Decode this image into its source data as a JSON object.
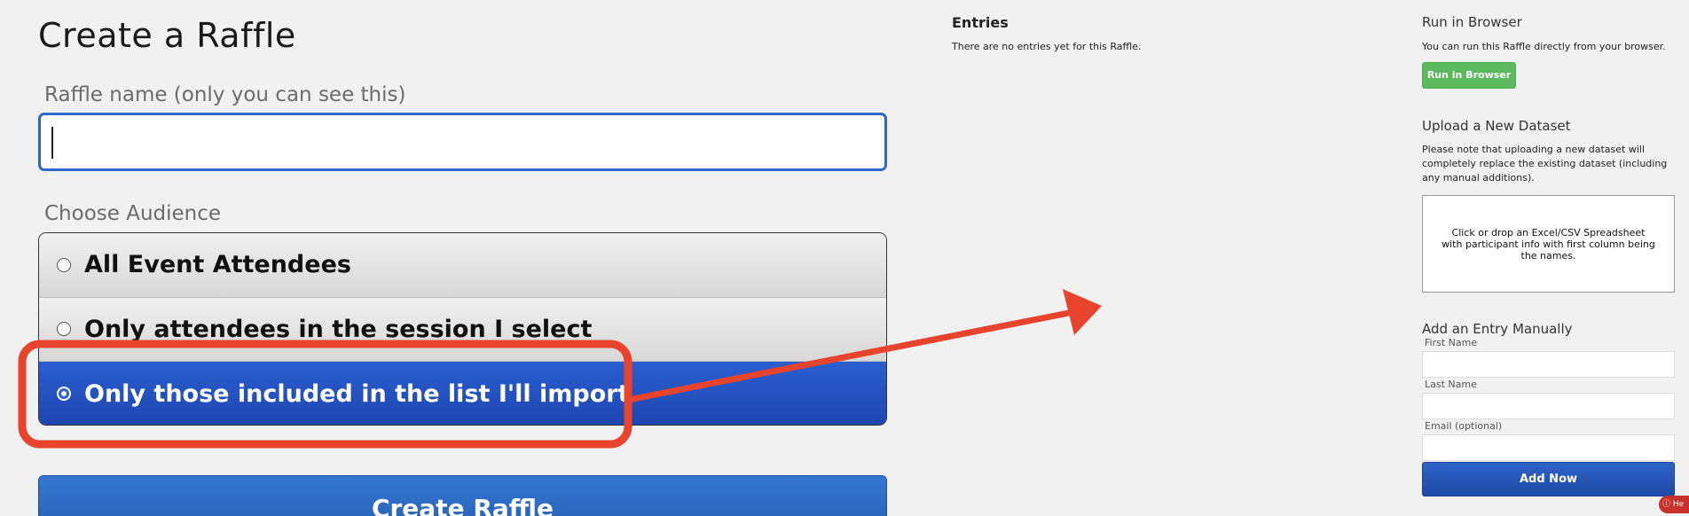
{
  "form": {
    "title": "Create a Raffle",
    "name_label": "Raffle name (only you can see this)",
    "name_value": "",
    "audience_label": "Choose Audience",
    "audience_options": [
      {
        "label": "All Event Attendees",
        "selected": false
      },
      {
        "label": "Only attendees in the session I select",
        "selected": false
      },
      {
        "label": "Only those included in the list I'll import",
        "selected": true
      }
    ],
    "create_button": "Create Raffle"
  },
  "entries": {
    "title": "Entries",
    "empty_text": "There are no entries yet for this Raffle."
  },
  "sidebar": {
    "run_title": "Run in Browser",
    "run_text": "You can run this Raffle directly from your browser.",
    "run_button": "Run in Browser",
    "upload_title": "Upload a New Dataset",
    "upload_text": "Please note that uploading a new dataset will completely replace the existing dataset (including any manual additions).",
    "dropzone_text": "Click or drop an Excel/CSV Spreadsheet with participant info with first column being the names.",
    "manual_title": "Add an Entry Manually",
    "first_name_label": "First Name",
    "last_name_label": "Last Name",
    "email_label": "Email (optional)",
    "add_button": "Add Now",
    "help_badge": "He"
  },
  "colors": {
    "accent_blue": "#2a5ecf",
    "annotation_red": "#e8432d",
    "run_green": "#5cb85c"
  }
}
